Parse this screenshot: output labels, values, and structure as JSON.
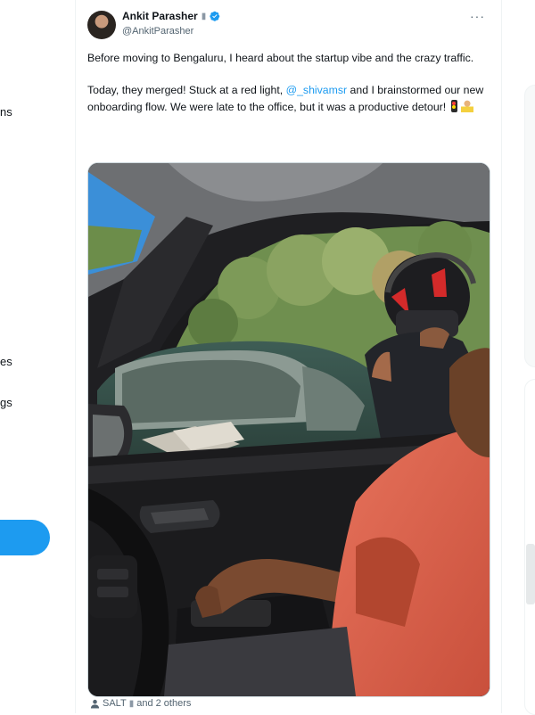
{
  "left_nav": {
    "fragments": [
      {
        "text": "ns"
      },
      {
        "text": "es"
      },
      {
        "text": "gs"
      }
    ]
  },
  "tweet": {
    "author": {
      "display_name": "Ankit Parasher",
      "flag_icon": "bottle-emoji-icon",
      "verified_icon": "verified-badge-icon",
      "handle": "@AnkitParasher"
    },
    "more_icon": "more-options-icon",
    "text": {
      "paragraph1": "Before moving to Bengaluru, I heard about the startup vibe and the crazy traffic.",
      "paragraph2_part1": "Today, they merged!  Stuck at a red light, ",
      "mention": "@_shivamsr",
      "paragraph2_part2": "  and I brainstormed our new onboarding flow. We were late to the office, but it was a productive detour! "
    },
    "media": {
      "alt": "photo-from-car-at-red-light"
    },
    "liked_by": {
      "icon": "person-icon",
      "name": "SALT",
      "flag": "bottle-emoji-icon",
      "others": "and 2 others"
    }
  },
  "colors": {
    "accent": "#1d9bf0",
    "text": "#0f1419",
    "secondary_text": "#536471",
    "border": "#eff3f4"
  }
}
